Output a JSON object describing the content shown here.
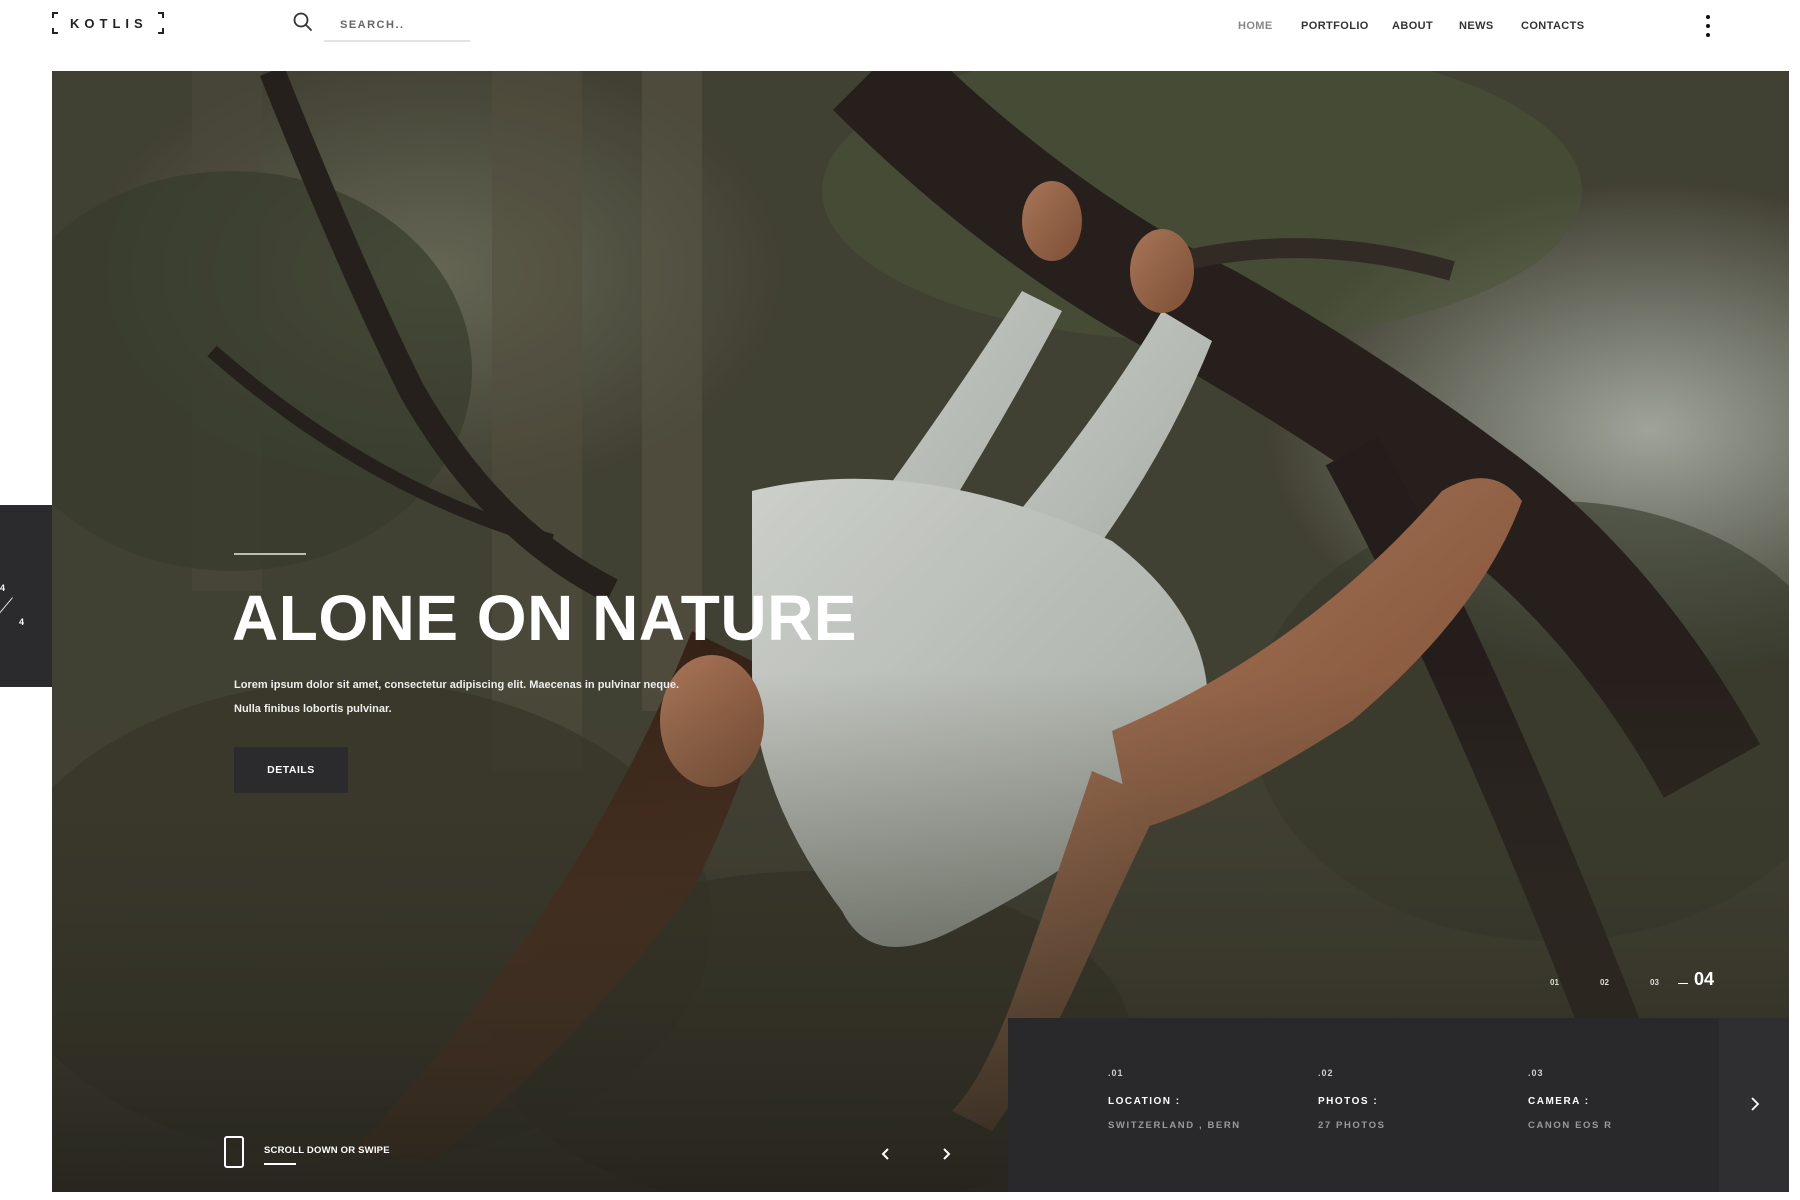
{
  "header": {
    "logo_text": "KOTLIS",
    "search": {
      "placeholder": "SEARCH..",
      "value": ""
    },
    "nav": [
      {
        "label": "HOME",
        "active": true
      },
      {
        "label": "PORTFOLIO",
        "active": false
      },
      {
        "label": "ABOUT",
        "active": false
      },
      {
        "label": "NEWS",
        "active": false
      },
      {
        "label": "CONTACTS",
        "active": false
      }
    ],
    "menu_icon": "kebab-menu-icon"
  },
  "side_pager": {
    "current": "4",
    "total": "4"
  },
  "hero": {
    "title": "ALONE ON NATURE",
    "description_line1": "Lorem ipsum dolor sit amet, consectetur adipiscing elit. Maecenas in pulvinar neque.",
    "description_line2": "Nulla finibus lobortis pulvinar.",
    "button_label": "DETAILS",
    "scroll_hint": "SCROLL DOWN OR SWIPE",
    "prev_icon": "chevron-left-icon",
    "next_icon": "chevron-right-icon"
  },
  "slides": {
    "numbers": [
      "01",
      "02",
      "03"
    ],
    "current": "04"
  },
  "info": {
    "items": [
      {
        "num": ".01",
        "label": "LOCATION :",
        "value": "SWITZERLAND , BERN"
      },
      {
        "num": ".02",
        "label": "PHOTOS :",
        "value": "27 PHOTOS"
      },
      {
        "num": ".03",
        "label": "CAMERA :",
        "value": "CANON EOS R"
      }
    ],
    "next_icon": "chevron-right-icon"
  },
  "colors": {
    "dark_panel": "#2b2b2d",
    "info_panel": "#29282a",
    "text_on_dark": "#ffffff",
    "nav_active": "#888888"
  }
}
